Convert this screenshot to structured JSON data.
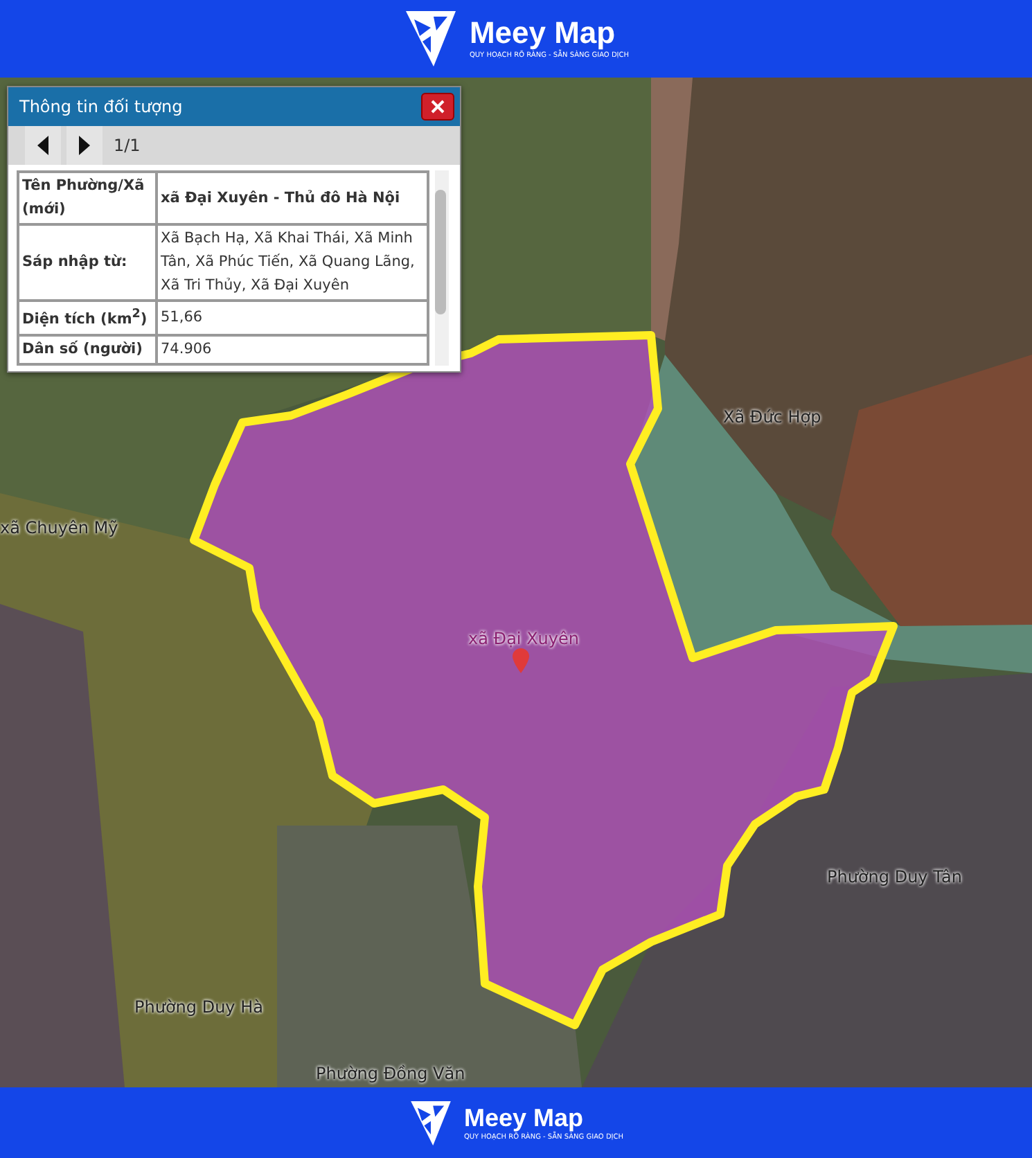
{
  "header": {
    "brand": "Meey Map",
    "tagline": "QUY HOẠCH RÕ RÀNG - SẴN SÀNG GIAO DỊCH"
  },
  "popup": {
    "title": "Thông tin đối tượng",
    "page": "1/1",
    "rows": [
      {
        "label": "Tên Phường/Xã (mới)",
        "value": "xã Đại Xuyên - Thủ đô Hà Nội",
        "value_bold": true
      },
      {
        "label": "Sáp nhập từ:",
        "value": "Xã Bạch Hạ, Xã Khai Thái, Xã Minh Tân, Xã Phúc Tiến, Xã Quang Lãng, Xã Tri Thủy, Xã Đại Xuyên",
        "value_bold": false
      },
      {
        "label": "Diện tích (km$^{2}$)",
        "value": "51,66",
        "value_bold": false
      },
      {
        "label": "Dân số (người)",
        "value": "74.906",
        "value_bold": false
      }
    ]
  },
  "map": {
    "selected_area": {
      "label": "xã Đại Xuyên"
    },
    "labels": [
      {
        "text": "Xã Đức Hợp"
      },
      {
        "text": "xã Chuyên Mỹ"
      },
      {
        "text": "Phường Duy Tân"
      },
      {
        "text": "Phường Duy Hà"
      },
      {
        "text": "Phường Đồng Văn"
      }
    ]
  },
  "footer": {
    "brand": "Meey Map",
    "tagline": "QUY HOẠCH RÕ RÀNG - SẴN SÀNG GIAO DỊCH"
  }
}
